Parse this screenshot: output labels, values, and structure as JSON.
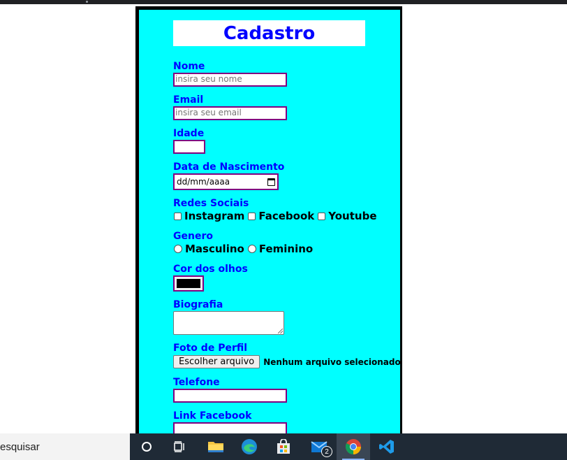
{
  "form": {
    "title": "Cadastro",
    "fields": {
      "nome": {
        "label": "Nome",
        "placeholder": "insira seu nome"
      },
      "email": {
        "label": "Email",
        "placeholder": "insira seu email"
      },
      "idade": {
        "label": "Idade"
      },
      "nascimento": {
        "label": "Data de Nascimento",
        "value": "dd/mm/aaaa"
      },
      "redes": {
        "label": "Redes Sociais",
        "options": [
          "Instagram",
          "Facebook",
          "Youtube"
        ]
      },
      "genero": {
        "label": "Genero",
        "options": [
          "Masculino",
          "Feminino"
        ]
      },
      "olhos": {
        "label": "Cor dos olhos",
        "value": "#000000"
      },
      "biografia": {
        "label": "Biografia"
      },
      "foto": {
        "label": "Foto de Perfil",
        "button": "Escolher arquivo",
        "status": "Nenhum arquivo selecionado"
      },
      "telefone": {
        "label": "Telefone"
      },
      "facebook": {
        "label": "Link Facebook"
      }
    }
  },
  "taskbar": {
    "search_text": "esquisar",
    "icons": [
      "cortana-icon",
      "task-view-icon",
      "file-explorer-icon",
      "edge-icon",
      "store-icon",
      "mail-icon",
      "chrome-icon",
      "vscode-icon"
    ],
    "mail_badge": "2"
  },
  "colors": {
    "panel_bg": "#00ffff",
    "label": "#0000ff",
    "input_border": "#800080"
  }
}
